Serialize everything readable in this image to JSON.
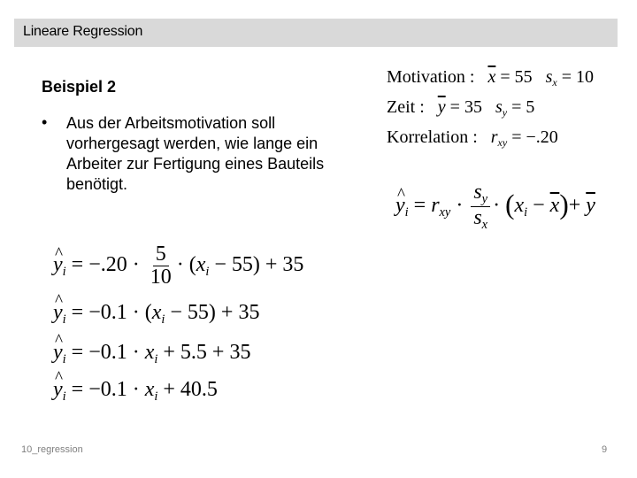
{
  "header": {
    "title": "Lineare Regression"
  },
  "slide": {
    "subtitle": "Beispiel 2",
    "bullet_symbol": "•",
    "bullet_text": "Aus der Arbeitsmotivation soll vorhergesagt werden, wie lange ein Arbeiter zur Fertigung eines Bauteils benötigt."
  },
  "stats": {
    "motivation": {
      "label": "Motivation :",
      "mean_symbol": "x",
      "mean_value": "55",
      "sd_symbol": "s",
      "sd_sub": "x",
      "sd_value": "10"
    },
    "zeit": {
      "label": "Zeit :",
      "mean_symbol": "y",
      "mean_value": "35",
      "sd_symbol": "s",
      "sd_sub": "y",
      "sd_value": "5"
    },
    "korrelation": {
      "label": "Korrelation :",
      "symbol": "r",
      "sub": "xy",
      "value": "−.20"
    }
  },
  "formula": {
    "lhs": "y",
    "lhs_sub": "i",
    "eq": "=",
    "r": "r",
    "r_sub": "xy",
    "num": "s",
    "num_sub": "y",
    "den": "s",
    "den_sub": "x",
    "xi": "x",
    "xi_sub": "i",
    "minus": "−",
    "xbar": "x",
    "plus": "+",
    "ybar": "y"
  },
  "derivation": [
    {
      "lhs": "y",
      "sub": "i",
      "rhs_a": "= −.20 ·",
      "frac_num": "5",
      "frac_den": "10",
      "rhs_b": "· (",
      "x": "x",
      "xsub": "i",
      "rhs_c": " − 55) + 35"
    },
    {
      "lhs": "y",
      "sub": "i",
      "rhs_a": "= −0.1 · (",
      "x": "x",
      "xsub": "i",
      "rhs_c": " − 55) + 35"
    },
    {
      "lhs": "y",
      "sub": "i",
      "rhs_a": "= −0.1 · ",
      "x": "x",
      "xsub": "i",
      "rhs_c": " + 5.5 + 35"
    },
    {
      "lhs": "y",
      "sub": "i",
      "rhs_a": "= −0.1 · ",
      "x": "x",
      "xsub": "i",
      "rhs_c": " + 40.5"
    }
  ],
  "footer": {
    "left": "10_regression",
    "page_number": "9"
  }
}
